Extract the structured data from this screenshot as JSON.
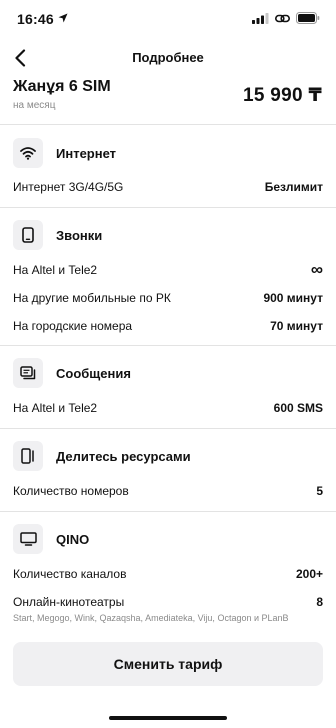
{
  "status": {
    "time": "16:46"
  },
  "nav": {
    "title": "Подробнее"
  },
  "plan": {
    "name": "Жанұя 6 SIM",
    "period": "на месяц",
    "price": "15 990 ₸"
  },
  "sections": {
    "internet": {
      "title": "Интернет",
      "rows": [
        {
          "label": "Интернет 3G/4G/5G",
          "value": "Безлимит"
        }
      ]
    },
    "calls": {
      "title": "Звонки",
      "rows": [
        {
          "label": "На Altel и Tele2",
          "value": "∞"
        },
        {
          "label": "На другие мобильные по РК",
          "value": "900 минут"
        },
        {
          "label": "На городские номера",
          "value": "70 минут"
        }
      ]
    },
    "messages": {
      "title": "Сообщения",
      "rows": [
        {
          "label": "На Altel и Tele2",
          "value": "600 SMS"
        }
      ]
    },
    "sharing": {
      "title": "Делитесь ресурсами",
      "rows": [
        {
          "label": "Количество номеров",
          "value": "5"
        }
      ]
    },
    "qino": {
      "title": "QINO",
      "rows": [
        {
          "label": "Количество каналов",
          "value": "200+"
        },
        {
          "label": "Онлайн-кинотеатры",
          "value": "8"
        }
      ],
      "cinemas_note": "Start, Megogo, Wink, Qazaqsha, Amediateka, Viju, Octagon и PLanB"
    }
  },
  "cta": {
    "label": "Сменить тариф"
  },
  "icons": {
    "back": "chevron-left-icon",
    "internet": "wifi-icon",
    "calls": "phone-icon",
    "messages": "message-icon",
    "sharing": "share-devices-icon",
    "qino": "tv-icon"
  }
}
